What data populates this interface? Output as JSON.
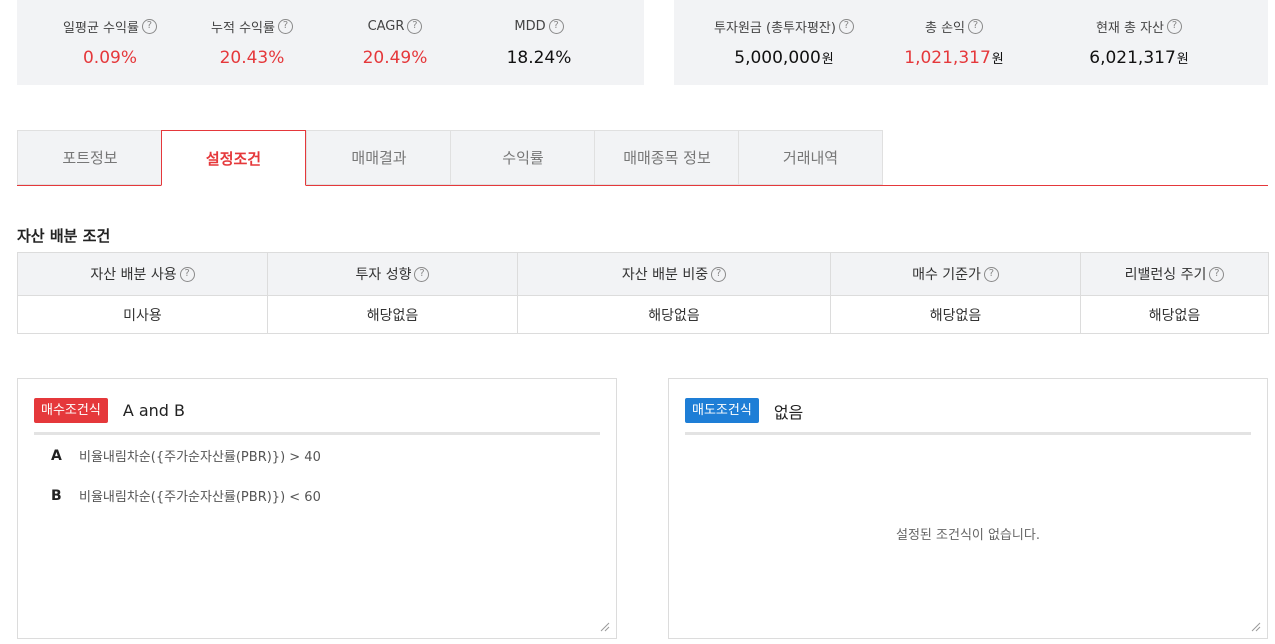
{
  "summary_left": [
    {
      "label": "일평균 수익률",
      "value": "0.09%",
      "color": "red"
    },
    {
      "label": "누적 수익률",
      "value": "20.43%",
      "color": "red"
    },
    {
      "label": "CAGR",
      "value": "20.49%",
      "color": "red"
    },
    {
      "label": "MDD",
      "value": "18.24%",
      "color": "black"
    }
  ],
  "summary_right": [
    {
      "label": "투자원금 (총투자평잔)",
      "value": "5,000,000",
      "unit": "원",
      "color": "black"
    },
    {
      "label": "총 손익",
      "value": "1,021,317",
      "unit": "원",
      "color": "red"
    },
    {
      "label": "현재 총 자산",
      "value": "6,021,317",
      "unit": "원",
      "color": "black"
    }
  ],
  "help_glyph": "?",
  "tabs": [
    "포트정보",
    "설정조건",
    "매매결과",
    "수익률",
    "매매종목 정보",
    "거래내역"
  ],
  "active_tab": "설정조건",
  "allocation": {
    "title": "자산 배분 조건",
    "headers": [
      "자산 배분 사용",
      "투자 성향",
      "자산 배분 비중",
      "매수 기준가",
      "리밸런싱 주기"
    ],
    "values": [
      "미사용",
      "해당없음",
      "해당없음",
      "해당없음",
      "해당없음"
    ]
  },
  "buy_condition": {
    "badge": "매수조건식",
    "expression": "A and B",
    "rows": [
      {
        "key": "A",
        "text": "비율내림차순({주가순자산률(PBR)}) > 40"
      },
      {
        "key": "B",
        "text": "비율내림차순({주가순자산률(PBR)}) < 60"
      }
    ]
  },
  "sell_condition": {
    "badge": "매도조건식",
    "expression": "없음",
    "empty_message": "설정된 조건식이 없습니다."
  },
  "colors": {
    "accent_red": "#e5383b",
    "accent_blue": "#1e7ed6",
    "panel_bg": "#f2f3f5"
  }
}
